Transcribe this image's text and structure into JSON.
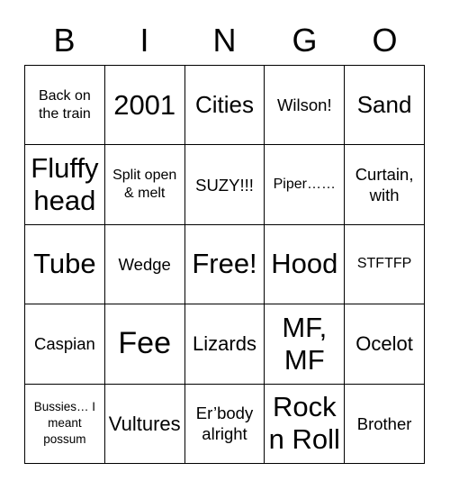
{
  "card": {
    "header_letters": [
      "B",
      "I",
      "N",
      "G",
      "O"
    ],
    "rows": [
      [
        {
          "text": "Back on the train",
          "size": "sz-sm"
        },
        {
          "text": "2001",
          "size": "sz-xxl"
        },
        {
          "text": "Cities",
          "size": "sz-xl"
        },
        {
          "text": "Wilson!",
          "size": "sz-md"
        },
        {
          "text": "Sand",
          "size": "sz-xl"
        }
      ],
      [
        {
          "text": "Fluffy head",
          "size": "sz-xxl"
        },
        {
          "text": "Split open & melt",
          "size": "sz-sm"
        },
        {
          "text": "SUZY!!!",
          "size": "sz-md"
        },
        {
          "text": "Piper……",
          "size": "sz-sm"
        },
        {
          "text": "Curtain, with",
          "size": "sz-md"
        }
      ],
      [
        {
          "text": "Tube",
          "size": "sz-xxl"
        },
        {
          "text": "Wedge",
          "size": "sz-md"
        },
        {
          "text": "Free!",
          "size": "sz-xxl"
        },
        {
          "text": "Hood",
          "size": "sz-xxl"
        },
        {
          "text": "STFTFP",
          "size": "sz-sm"
        }
      ],
      [
        {
          "text": "Caspian",
          "size": "sz-md"
        },
        {
          "text": "Fee",
          "size": "sz-huge"
        },
        {
          "text": "Lizards",
          "size": "sz-lg"
        },
        {
          "text": "MF, MF",
          "size": "sz-xxl"
        },
        {
          "text": "Ocelot",
          "size": "sz-lg"
        }
      ],
      [
        {
          "text": "Bussies… I meant possum",
          "size": "sz-xs"
        },
        {
          "text": "Vultures",
          "size": "sz-lg"
        },
        {
          "text": "Er’body alright",
          "size": "sz-md"
        },
        {
          "text": "Rock n Roll",
          "size": "sz-xxl"
        },
        {
          "text": "Brother",
          "size": "sz-md"
        }
      ]
    ]
  }
}
